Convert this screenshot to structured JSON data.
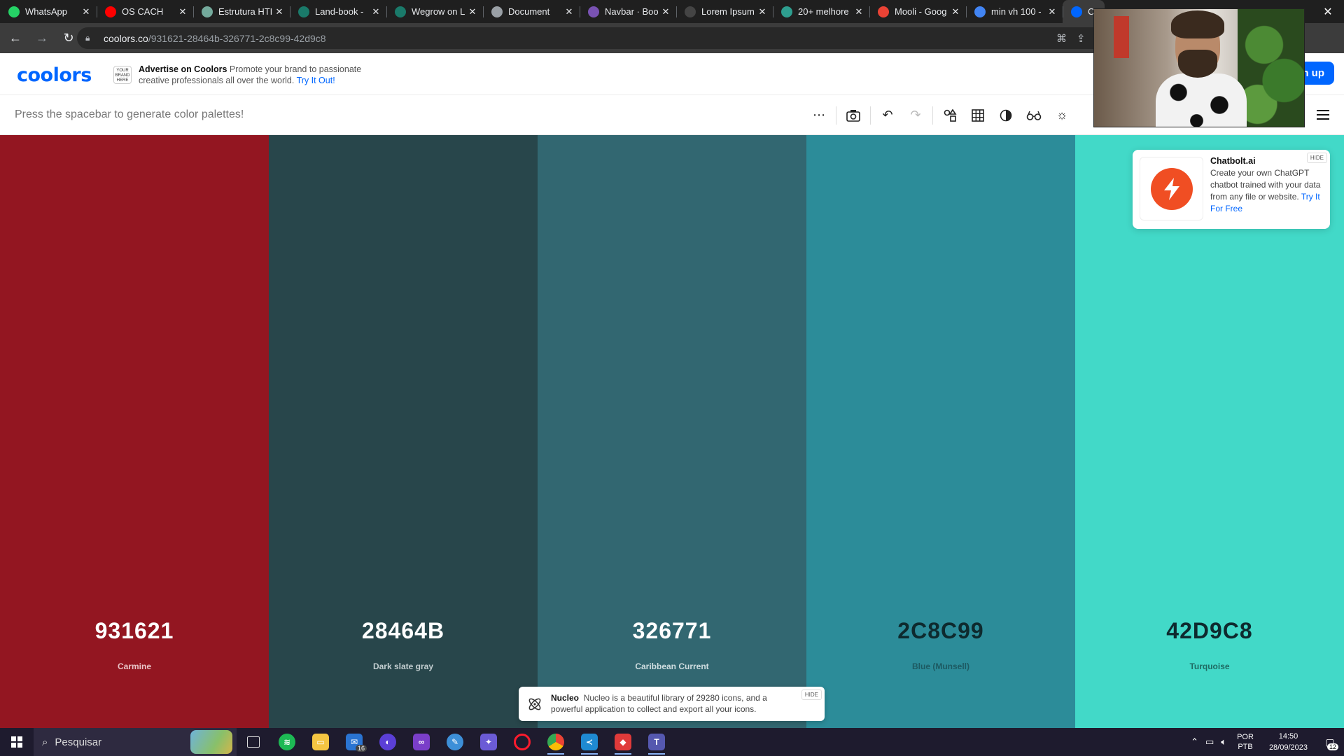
{
  "browser": {
    "tabs": [
      {
        "title": "WhatsApp",
        "icon": "whatsapp-icon",
        "color": "#25d366"
      },
      {
        "title": "OS CACH",
        "icon": "youtube-icon",
        "color": "#ff0000"
      },
      {
        "title": "Estrutura HTI",
        "icon": "chatgpt-icon",
        "color": "#74aa9c"
      },
      {
        "title": "Land-book -",
        "icon": "landbook-icon",
        "color": "#1a7a6a"
      },
      {
        "title": "Wegrow on L",
        "icon": "landbook-icon",
        "color": "#1a7a6a"
      },
      {
        "title": "Document",
        "icon": "globe-icon",
        "color": "#9aa0a6"
      },
      {
        "title": "Navbar · Boo",
        "icon": "bootstrap-icon",
        "color": "#7952b3"
      },
      {
        "title": "Lorem Ipsum",
        "icon": "lorem-icon",
        "color": "#444444"
      },
      {
        "title": "20+ melhore",
        "icon": "site-icon",
        "color": "#2e9e8f"
      },
      {
        "title": "Mooli - Goog",
        "icon": "google-fonts-icon",
        "color": "#ea4335"
      },
      {
        "title": "min vh 100 -",
        "icon": "google-icon",
        "color": "#4285f4"
      },
      {
        "title": "Cr",
        "icon": "coolors-icon",
        "color": "#0066ff"
      }
    ],
    "url_host": "coolors.co",
    "url_path": "/931621-28464b-326771-2c8c99-42d9c8"
  },
  "header": {
    "logo": "coolors",
    "brand_badge": "YOUR BRAND HERE",
    "ad_title": "Advertise on Coolors",
    "ad_text": "Promote your brand to passionate creative professionals all over the world.",
    "ad_link": "Try It Out!",
    "signup_label": "n up"
  },
  "toolbar": {
    "hint": "Press the spacebar to generate color palettes!",
    "tools": [
      "more-icon",
      "camera-icon",
      "undo-icon",
      "redo-icon",
      "shapes-icon",
      "grid-icon",
      "contrast-icon",
      "glasses-icon",
      "sun-icon"
    ]
  },
  "palette": [
    {
      "hex": "931621",
      "name": "Carmine",
      "bg": "#931621",
      "fg": "#ffffff",
      "sub": "#e9c4c7"
    },
    {
      "hex": "28464B",
      "name": "Dark slate gray",
      "bg": "#28464b",
      "fg": "#ffffff",
      "sub": "#c3ced0"
    },
    {
      "hex": "326771",
      "name": "Caribbean Current",
      "bg": "#326771",
      "fg": "#ffffff",
      "sub": "#cfdde0"
    },
    {
      "hex": "2C8C99",
      "name": "Blue (Munsell)",
      "bg": "#2c8c99",
      "fg": "#0e2a2e",
      "sub": "#1d5a62"
    },
    {
      "hex": "42D9C8",
      "name": "Turquoise",
      "bg": "#42d9c8",
      "fg": "#0e2a2e",
      "sub": "#1f6b63"
    }
  ],
  "chatbolt_ad": {
    "title": "Chatbolt.ai",
    "text": "Create your own ChatGPT chatbot trained with your data from any file or website.",
    "link": "Try It For Free",
    "hide": "HIDE"
  },
  "nucleo_ad": {
    "title": "Nucleo",
    "text": "Nucleo is a beautiful library of 29280 icons, and a powerful application to collect and export all your icons.",
    "hide": "HIDE"
  },
  "taskbar": {
    "search_placeholder": "Pesquisar",
    "mail_badge": "16",
    "lang_line1": "POR",
    "lang_line2": "PTB",
    "time": "14:50",
    "date": "28/09/2023",
    "notifications": "12"
  }
}
